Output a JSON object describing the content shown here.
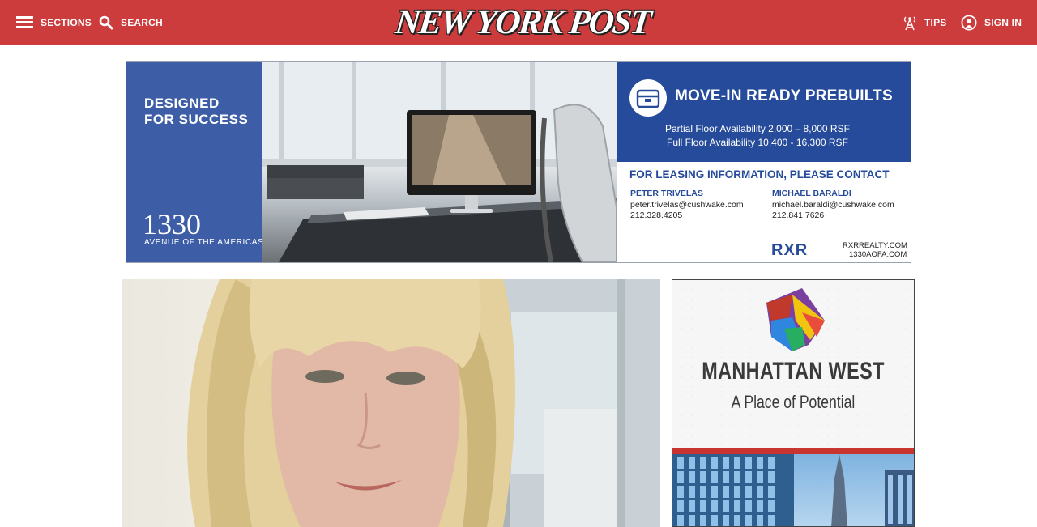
{
  "header": {
    "sections_label": "SECTIONS",
    "search_label": "SEARCH",
    "logo_text": "NEW YORK POST",
    "tips_label": "TIPS",
    "signin_label": "SIGN IN",
    "background_color": "#cd3c3c",
    "icons": [
      "menu-icon",
      "search-icon",
      "tips-antenna-icon",
      "user-icon"
    ]
  },
  "ad_top": {
    "heading_line1": "DESIGNED",
    "heading_line2": "FOR SUCCESS",
    "building_number": "1330",
    "building_address": "AVENUE OF THE AMERICAS",
    "headline": "MOVE-IN READY PREBUILTS",
    "partial_floor": "Partial Floor Availability 2,000 – 8,000 RSF",
    "full_floor": "Full Floor Availability 10,400 - 16,300 RSF",
    "contact_heading": "FOR LEASING INFORMATION, PLEASE CONTACT",
    "contacts": [
      {
        "name": "PETER TRIVELAS",
        "email": "peter.trivelas@cushwake.com",
        "phone": "212.328.4205"
      },
      {
        "name": "MICHAEL BARALDI",
        "email": "michael.baraldi@cushwake.com",
        "phone": "212.841.7626"
      }
    ],
    "brand": "RXR",
    "url1": "RXRREALTY.COM",
    "url2": "1330AOFA.COM",
    "accent_color": "#264b9a"
  },
  "ad_side": {
    "title": "MANHATTAN WEST",
    "tagline": "A Place of Potential",
    "logo_text": "MANHATTAN WEST",
    "accent_color": "#c8342f"
  },
  "article": {
    "photo_icon": "portrait-photo"
  }
}
